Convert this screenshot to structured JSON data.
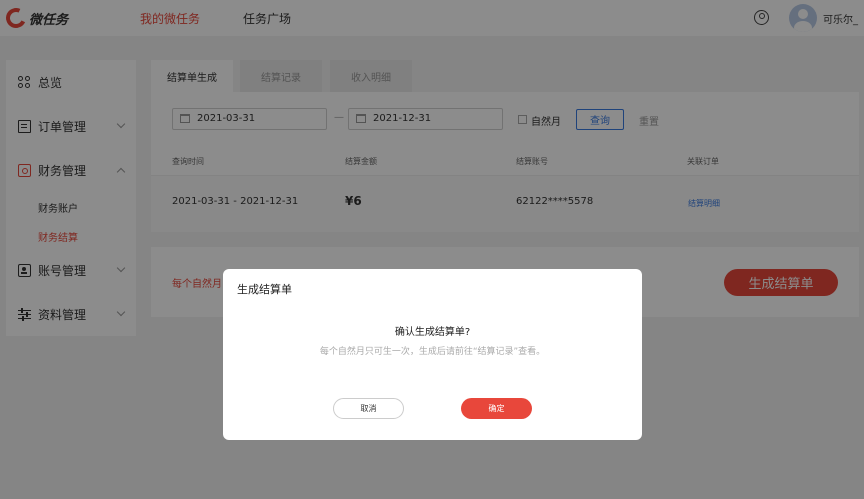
{
  "app": {
    "logo_text": "微任务"
  },
  "nav": {
    "items": [
      {
        "label": "我的微任务",
        "active": true
      },
      {
        "label": "任务广场",
        "active": false
      }
    ]
  },
  "user": {
    "name": "可乐尔_"
  },
  "sidebar": {
    "items": [
      {
        "label": "总览",
        "icon": "overview-icon"
      },
      {
        "label": "订单管理",
        "icon": "order-icon"
      },
      {
        "label": "财务管理",
        "icon": "finance-icon",
        "expanded": true
      },
      {
        "label": "账号管理",
        "icon": "account-icon"
      },
      {
        "label": "资料管理",
        "icon": "profile-icon"
      }
    ],
    "finance_sub": [
      {
        "label": "财务账户"
      },
      {
        "label": "财务结算",
        "active": true
      }
    ]
  },
  "tabs": [
    {
      "label": "结算单生成",
      "active": true
    },
    {
      "label": "结算记录"
    },
    {
      "label": "收入明细"
    }
  ],
  "filter": {
    "start_date": "2021-03-31",
    "separator": "—",
    "end_date": "2021-12-31",
    "natural_month_label": "自然月",
    "natural_month_checked": false,
    "query_label": "查询",
    "reset_label": "重置"
  },
  "table": {
    "headers": [
      "查询时间",
      "结算金额",
      "结算账号",
      "关联订单"
    ],
    "rows": [
      {
        "time": "2021-03-31 - 2021-12-31",
        "amount": "¥6",
        "account": "62122****5578",
        "order_link": "结算明细"
      }
    ]
  },
  "generate_panel": {
    "note": "每个自然月",
    "button_label": "生成结算单"
  },
  "modal": {
    "title": "生成结算单",
    "question": "确认生成结算单?",
    "description": "每个自然月只可生一次，生成后请前往“结算记录”查看。",
    "cancel_label": "取消",
    "ok_label": "确定"
  },
  "colors": {
    "accent": "#e8473b",
    "link": "#3a7ae0"
  }
}
